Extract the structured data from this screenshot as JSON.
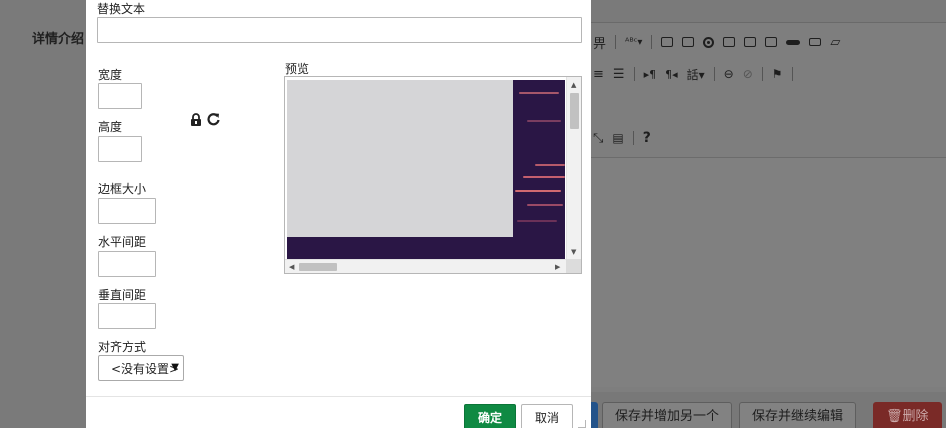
{
  "background_page": {
    "field_label": "详情介绍",
    "toolbar_icons": [
      "format-icon",
      "spellcheck-icon",
      "form-icon",
      "checkbox-icon",
      "radio-icon",
      "textfield-icon",
      "textarea-icon",
      "select-icon",
      "button-icon",
      "imagebutton-icon",
      "hiddenfield-icon",
      "align-center-icon",
      "align-justify-icon",
      "ltr-icon",
      "rtl-icon",
      "language-icon",
      "link-icon",
      "unlink-icon",
      "anchor-icon",
      "maximize-icon",
      "showblocks-icon",
      "help-icon"
    ],
    "help_symbol": "?",
    "buttons": {
      "save_add_another": "保存并增加另一个",
      "save_continue": "保存并继续编辑",
      "delete": "删除"
    }
  },
  "dialog": {
    "alt_text_label": "替换文本",
    "alt_text_value": "",
    "width_label": "宽度",
    "width_value": "",
    "height_label": "高度",
    "height_value": "",
    "border_label": "边框大小",
    "border_value": "",
    "hspace_label": "水平间距",
    "hspace_value": "",
    "vspace_label": "垂直间距",
    "vspace_value": "",
    "align_label": "对齐方式",
    "align_selected": "<没有设置>",
    "preview_label": "预览",
    "ok_button": "确定",
    "cancel_button": "取消"
  },
  "colors": {
    "ok_green": "#0f8a43",
    "preview_dark": "#2a1645",
    "preview_gray": "#d5d5d7",
    "overlay": "#7a7a7a"
  }
}
